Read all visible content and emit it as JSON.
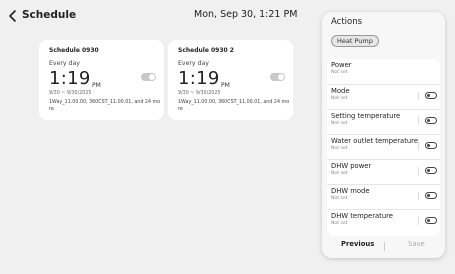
{
  "header": {
    "back_icon": "chevron-left-icon",
    "title": "Schedule",
    "datetime": "Mon, Sep 30, 1:21 PM"
  },
  "schedules": [
    {
      "title": "Schedule 0930",
      "frequency": "Every day",
      "time": "1:19",
      "ampm": "PM",
      "date_range": "9/30 ~ 9/30/2025",
      "devices": "1Way_11.00.00, 360CST_11.00.01, and 24 mo re",
      "enabled": false
    },
    {
      "title": "Schedule 0930 2",
      "frequency": "Every day",
      "time": "1:19",
      "ampm": "PM",
      "date_range": "9/30 ~ 9/30/2025",
      "devices": "1Way_11.00.00, 360CST_11.00.01, and 24 mo re",
      "enabled": false
    }
  ],
  "actions_panel": {
    "title": "Actions",
    "device_chip": "Heat Pump",
    "items": [
      {
        "name": "Power",
        "status": "Not set",
        "has_toggle": false
      },
      {
        "name": "Mode",
        "status": "Not set",
        "has_toggle": true
      },
      {
        "name": "Setting temperature",
        "status": "Not set",
        "has_toggle": true
      },
      {
        "name": "Water outlet temperature",
        "status": "Not set",
        "has_toggle": true
      },
      {
        "name": "DHW power",
        "status": "Not set",
        "has_toggle": true
      },
      {
        "name": "DHW mode",
        "status": "Not set",
        "has_toggle": true
      },
      {
        "name": "DHW temperature",
        "status": "Not set",
        "has_toggle": true
      }
    ],
    "previous_label": "Previous",
    "save_label": "Save"
  }
}
